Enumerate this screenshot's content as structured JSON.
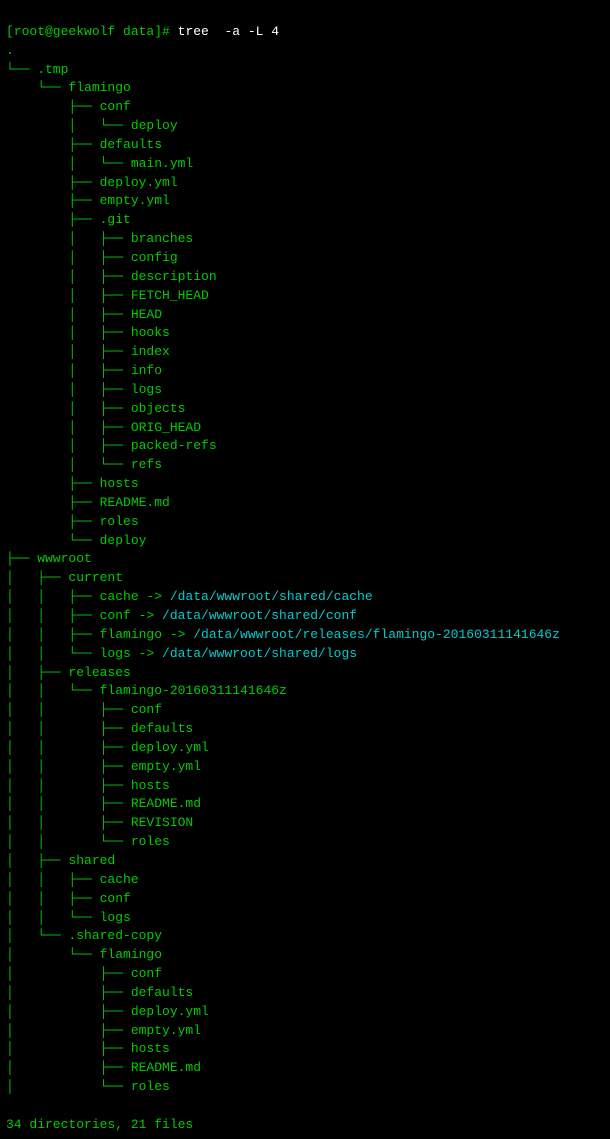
{
  "terminal": {
    "prompt": "[root@geekwolf data]# ",
    "command": "tree  -a -L 4",
    "lines": [
      {
        "text": ".",
        "type": "tree"
      },
      {
        "text": "└── .tmp",
        "type": "tree"
      },
      {
        "text": "    └── flamingo",
        "type": "tree"
      },
      {
        "text": "        ├── conf",
        "type": "tree"
      },
      {
        "text": "        │   └── deploy",
        "type": "tree"
      },
      {
        "text": "        ├── defaults",
        "type": "tree"
      },
      {
        "text": "        │   └── main.yml",
        "type": "tree"
      },
      {
        "text": "        ├── deploy.yml",
        "type": "tree"
      },
      {
        "text": "        ├── empty.yml",
        "type": "tree"
      },
      {
        "text": "        ├── .git",
        "type": "tree"
      },
      {
        "text": "        │   ├── branches",
        "type": "tree"
      },
      {
        "text": "        │   ├── config",
        "type": "tree"
      },
      {
        "text": "        │   ├── description",
        "type": "tree"
      },
      {
        "text": "        │   ├── FETCH_HEAD",
        "type": "tree"
      },
      {
        "text": "        │   ├── HEAD",
        "type": "tree"
      },
      {
        "text": "        │   ├── hooks",
        "type": "tree"
      },
      {
        "text": "        │   ├── index",
        "type": "tree"
      },
      {
        "text": "        │   ├── info",
        "type": "tree"
      },
      {
        "text": "        │   ├── logs",
        "type": "tree"
      },
      {
        "text": "        │   ├── objects",
        "type": "tree"
      },
      {
        "text": "        │   ├── ORIG_HEAD",
        "type": "tree"
      },
      {
        "text": "        │   ├── packed-refs",
        "type": "tree"
      },
      {
        "text": "        │   └── refs",
        "type": "tree"
      },
      {
        "text": "        ├── hosts",
        "type": "tree"
      },
      {
        "text": "        ├── README.md",
        "type": "tree"
      },
      {
        "text": "        ├── roles",
        "type": "tree"
      },
      {
        "text": "        └── deploy",
        "type": "tree"
      },
      {
        "text": "├── wwwroot",
        "type": "tree"
      },
      {
        "text": "│   ├── current",
        "type": "tree"
      },
      {
        "text": "│   │   ├── cache -> /data/wwwroot/shared/cache",
        "type": "symlink"
      },
      {
        "text": "│   │   ├── conf -> /data/wwwroot/shared/conf",
        "type": "symlink"
      },
      {
        "text": "│   │   ├── flamingo -> /data/wwwroot/releases/flamingo-20160311141646z",
        "type": "symlink"
      },
      {
        "text": "│   │   └── logs -> /data/wwwroot/shared/logs",
        "type": "symlink"
      },
      {
        "text": "│   ├── releases",
        "type": "tree"
      },
      {
        "text": "│   │   └── flamingo-20160311141646z",
        "type": "tree"
      },
      {
        "text": "│   │       ├── conf",
        "type": "tree"
      },
      {
        "text": "│   │       ├── defaults",
        "type": "tree"
      },
      {
        "text": "│   │       ├── deploy.yml",
        "type": "tree"
      },
      {
        "text": "│   │       ├── empty.yml",
        "type": "tree"
      },
      {
        "text": "│   │       ├── hosts",
        "type": "tree"
      },
      {
        "text": "│   │       ├── README.md",
        "type": "tree"
      },
      {
        "text": "│   │       ├── REVISION",
        "type": "tree"
      },
      {
        "text": "│   │       └── roles",
        "type": "tree"
      },
      {
        "text": "│   ├── shared",
        "type": "tree"
      },
      {
        "text": "│   │   ├── cache",
        "type": "tree"
      },
      {
        "text": "│   │   ├── conf",
        "type": "tree"
      },
      {
        "text": "│   │   └── logs",
        "type": "tree"
      },
      {
        "text": "│   └── .shared-copy",
        "type": "tree"
      },
      {
        "text": "│       └── flamingo",
        "type": "tree"
      },
      {
        "text": "│           ├── conf",
        "type": "tree"
      },
      {
        "text": "│           ├── defaults",
        "type": "tree"
      },
      {
        "text": "│           ├── deploy.yml",
        "type": "tree"
      },
      {
        "text": "│           ├── empty.yml",
        "type": "tree"
      },
      {
        "text": "│           ├── hosts",
        "type": "tree"
      },
      {
        "text": "│           ├── README.md",
        "type": "tree"
      },
      {
        "text": "│           └── roles",
        "type": "tree"
      }
    ],
    "summary": "34 directories, 21 files"
  }
}
